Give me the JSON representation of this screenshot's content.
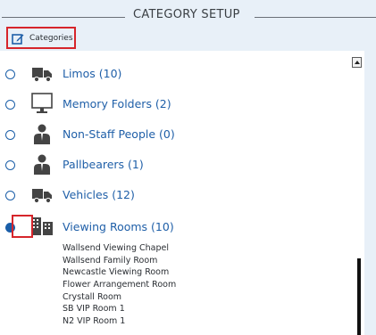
{
  "header": {
    "title": "CATEGORY SETUP"
  },
  "categories_button": {
    "label": "Categories",
    "icon": "edit-icon"
  },
  "categories": [
    {
      "label": "Limos (10)",
      "icon": "truck-icon",
      "selected": false
    },
    {
      "label": "Memory Folders (2)",
      "icon": "monitor-icon",
      "selected": false
    },
    {
      "label": "Non-Staff People (0)",
      "icon": "person-icon",
      "selected": false
    },
    {
      "label": "Pallbearers (1)",
      "icon": "person-icon",
      "selected": false
    },
    {
      "label": "Vehicles (12)",
      "icon": "truck-icon",
      "selected": false
    },
    {
      "label": "Viewing Rooms (10)",
      "icon": "building-icon",
      "selected": true
    }
  ],
  "viewing_rooms": [
    "Wallsend Viewing Chapel",
    "Wallsend Family Room",
    "Newcastle Viewing Room",
    "Flower Arrangement Room",
    "Crystall Room",
    "SB VIP Room 1",
    "N2 VIP Room 1"
  ],
  "colors": {
    "accent": "#1f5fa8",
    "highlight": "#d6252b",
    "background": "#e8f0f8"
  }
}
